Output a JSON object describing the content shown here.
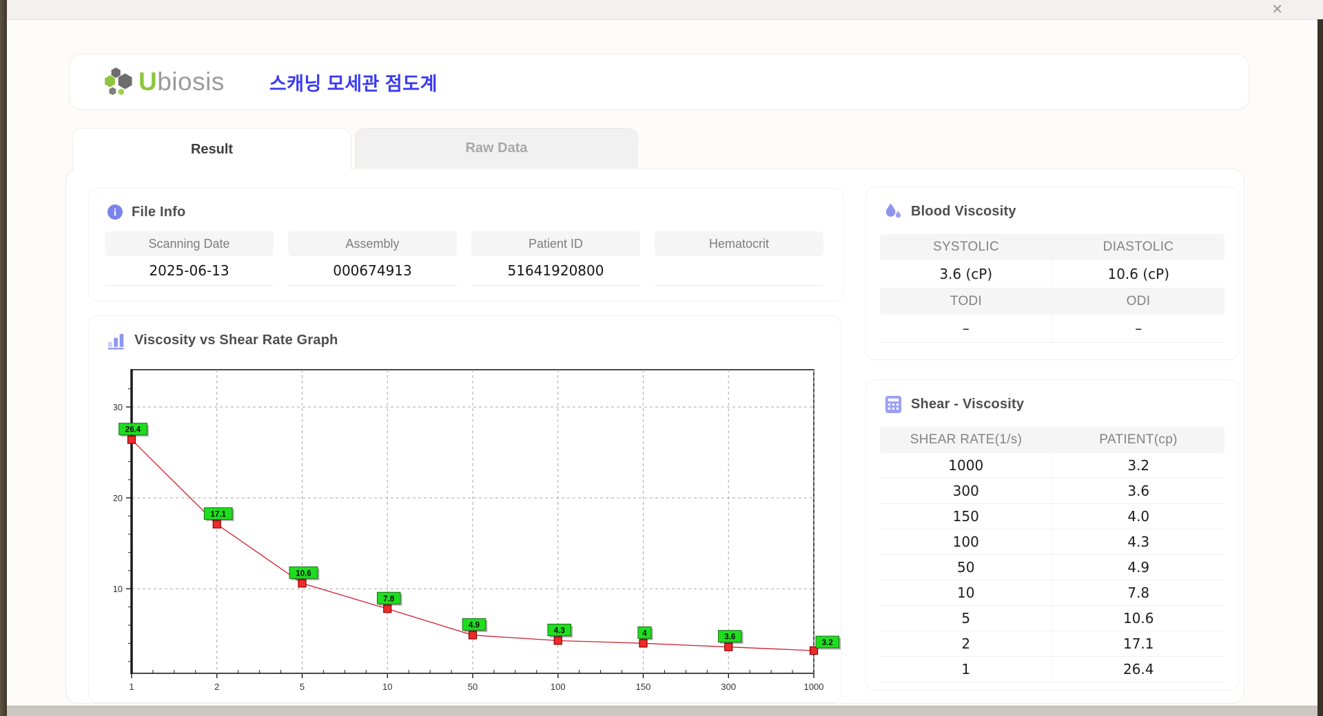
{
  "window": {
    "close_glyph": "✕"
  },
  "header": {
    "logo_accent": "U",
    "logo_rest": "biosis",
    "title": "스캐닝 모세관 점도계"
  },
  "tabs": [
    {
      "label": "Result",
      "active": true
    },
    {
      "label": "Raw Data",
      "active": false
    }
  ],
  "file_info": {
    "section_title": "File Info",
    "fields": [
      {
        "label": "Scanning Date",
        "value": "2025-06-13"
      },
      {
        "label": "Assembly",
        "value": "000674913"
      },
      {
        "label": "Patient ID",
        "value": "51641920800"
      },
      {
        "label": "Hematocrit",
        "value": ""
      }
    ]
  },
  "blood_viscosity": {
    "section_title": "Blood Viscosity",
    "rows": [
      {
        "headers": [
          "SYSTOLIC",
          "DIASTOLIC"
        ],
        "values": [
          "3.6 (cP)",
          "10.6 (cP)"
        ],
        "red": [
          false,
          false
        ]
      },
      {
        "headers": [
          "TODI",
          "ODI"
        ],
        "values": [
          "–",
          "–"
        ],
        "red": [
          false,
          false
        ]
      }
    ]
  },
  "graph": {
    "section_title": "Viscosity vs Shear Rate Graph"
  },
  "chart_data": {
    "type": "line",
    "title": "Viscosity vs Shear Rate Graph",
    "x": [
      1,
      2,
      5,
      10,
      50,
      100,
      150,
      300,
      1000
    ],
    "x_tick_labels": [
      "1",
      "2",
      "5",
      "10",
      "50",
      "100",
      "150",
      "300",
      "1000"
    ],
    "values": [
      26.4,
      17.1,
      10.6,
      7.8,
      4.9,
      4.3,
      4,
      3.6,
      3.2
    ],
    "point_labels": [
      "26.4",
      "17.1",
      "10.6",
      "7.8",
      "4.9",
      "4.3",
      "4",
      "3.6",
      "3.2"
    ],
    "xlabel": "",
    "ylabel": "",
    "y_ticks": [
      10,
      20,
      30
    ],
    "ylim": [
      0.7,
      34.1
    ],
    "grid": true,
    "x_axis_note": "categorical spacing of log-like shear rates",
    "line_color": "#cc2233",
    "marker_color": "#ee2b2b",
    "marker_edge": "#8d0000",
    "label_bg": "#1ede1e",
    "label_edge": "#1a6b1a",
    "grid_color": "#a8a8a8",
    "axis_color": "#1a1a1a"
  },
  "shear_viscosity": {
    "section_title": "Shear - Viscosity",
    "columns": [
      "SHEAR RATE(1/s)",
      "PATIENT(cp)"
    ],
    "rows": [
      {
        "shear_rate": "1000",
        "patient": "3.2",
        "highlight": false
      },
      {
        "shear_rate": "300",
        "patient": "3.6",
        "highlight": true
      },
      {
        "shear_rate": "150",
        "patient": "4.0",
        "highlight": false
      },
      {
        "shear_rate": "100",
        "patient": "4.3",
        "highlight": false
      },
      {
        "shear_rate": "50",
        "patient": "4.9",
        "highlight": false
      },
      {
        "shear_rate": "10",
        "patient": "7.8",
        "highlight": false
      },
      {
        "shear_rate": "5",
        "patient": "10.6",
        "highlight": true
      },
      {
        "shear_rate": "2",
        "patient": "17.1",
        "highlight": false
      },
      {
        "shear_rate": "1",
        "patient": "26.4",
        "highlight": false
      }
    ]
  },
  "colors": {
    "accent_purple": "#8f93f0",
    "title_blue": "#3a3af2",
    "logo_green": "#8dc63f",
    "logo_gray": "#9a9a9a",
    "highlight_red": "#cd2a27"
  }
}
